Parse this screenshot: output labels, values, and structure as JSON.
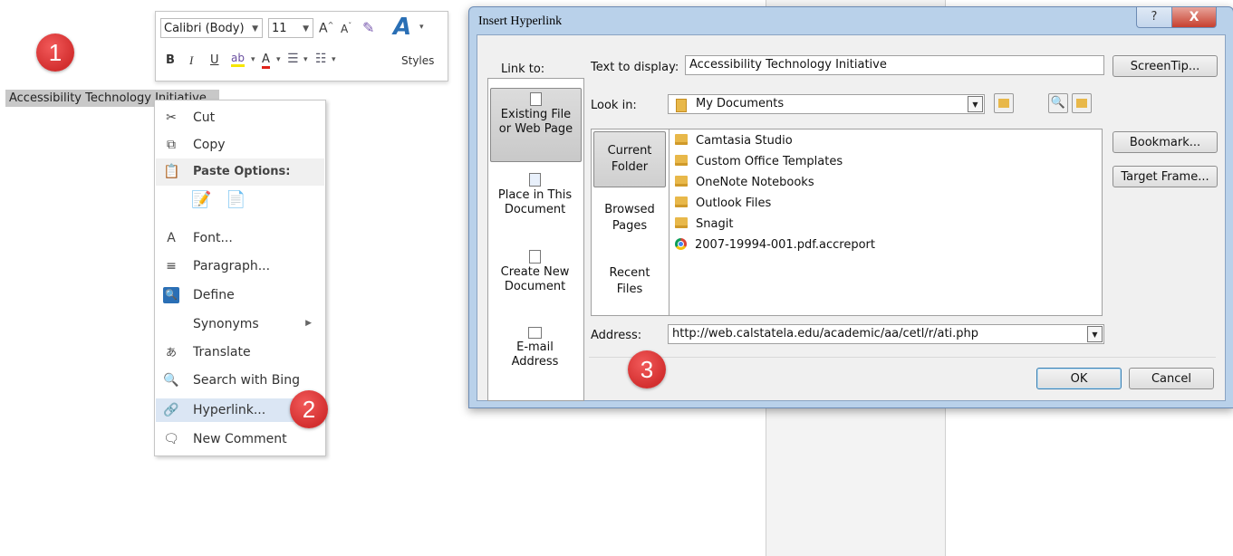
{
  "callouts": [
    "1",
    "2",
    "3"
  ],
  "selected_text": "Accessibility Technology Initiative",
  "mini_toolbar": {
    "font": "Calibri (Body)",
    "size": "11",
    "grow_label": "A",
    "shrink_label": "A",
    "bold": "B",
    "italic": "I",
    "underline": "U",
    "highlight_label": "ab",
    "font_color_label": "A",
    "styles_label": "Styles"
  },
  "context_menu": {
    "cut": "Cut",
    "copy": "Copy",
    "paste_options": "Paste Options:",
    "font": "Font...",
    "paragraph": "Paragraph...",
    "define": "Define",
    "synonyms": "Synonyms",
    "translate": "Translate",
    "search_bing": "Search with Bing",
    "hyperlink": "Hyperlink...",
    "new_comment": "New Comment"
  },
  "dialog": {
    "title": "Insert Hyperlink",
    "help_label": "?",
    "close_label": "X",
    "link_to_label": "Link to:",
    "text_to_display_label": "Text to display:",
    "text_to_display_value": "Accessibility Technology Initiative",
    "screentip_button": "ScreenTip...",
    "look_in_label": "Look in:",
    "look_in_value": "My Documents",
    "link_options": [
      {
        "label1": "Existing File",
        "label2": "or Web Page"
      },
      {
        "label1": "Place in This",
        "label2": "Document"
      },
      {
        "label1": "Create New",
        "label2": "Document"
      },
      {
        "label1": "E-mail",
        "label2": "Address"
      }
    ],
    "nav_options": [
      {
        "label1": "Current",
        "label2": "Folder"
      },
      {
        "label1": "Browsed",
        "label2": "Pages"
      },
      {
        "label1": "Recent",
        "label2": "Files"
      }
    ],
    "files": [
      {
        "name": "Camtasia Studio",
        "icon": "folder"
      },
      {
        "name": "Custom Office Templates",
        "icon": "folder"
      },
      {
        "name": "OneNote Notebooks",
        "icon": "folder"
      },
      {
        "name": "Outlook Files",
        "icon": "folder"
      },
      {
        "name": "Snagit",
        "icon": "folder"
      },
      {
        "name": "2007-19994-001.pdf.accreport",
        "icon": "chrome"
      }
    ],
    "bookmark_button": "Bookmark...",
    "target_frame_button": "Target Frame...",
    "address_label": "Address:",
    "address_value": "http://web.calstatela.edu/academic/aa/cetl/r/ati.php",
    "ok_button": "OK",
    "cancel_button": "Cancel"
  }
}
